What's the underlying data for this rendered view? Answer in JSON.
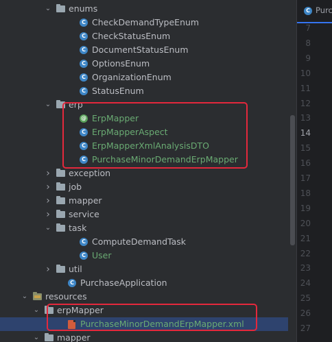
{
  "tree": {
    "rows": [
      {
        "indent": 4,
        "expand": "open",
        "icon": "folder-icon",
        "label": "enums",
        "green": false
      },
      {
        "indent": 6,
        "expand": "none",
        "icon": "class-icon",
        "label": "CheckDemandTypeEnum",
        "green": false
      },
      {
        "indent": 6,
        "expand": "none",
        "icon": "class-icon",
        "label": "CheckStatusEnum",
        "green": false
      },
      {
        "indent": 6,
        "expand": "none",
        "icon": "class-icon",
        "label": "DocumentStatusEnum",
        "green": false
      },
      {
        "indent": 6,
        "expand": "none",
        "icon": "class-icon",
        "label": "OptionsEnum",
        "green": false
      },
      {
        "indent": 6,
        "expand": "none",
        "icon": "class-icon",
        "label": "OrganizationEnum",
        "green": false
      },
      {
        "indent": 6,
        "expand": "none",
        "icon": "class-icon",
        "label": "StatusEnum",
        "green": false
      },
      {
        "indent": 4,
        "expand": "open",
        "icon": "folder-icon",
        "label": "erp",
        "green": false
      },
      {
        "indent": 6,
        "expand": "none",
        "icon": "annotation-icon",
        "label": "ErpMapper",
        "green": true
      },
      {
        "indent": 6,
        "expand": "none",
        "icon": "class-icon",
        "label": "ErpMapperAspect",
        "green": true
      },
      {
        "indent": 6,
        "expand": "none",
        "icon": "class-icon",
        "label": "ErpMapperXmlAnalysisDTO",
        "green": true
      },
      {
        "indent": 6,
        "expand": "none",
        "icon": "class-icon",
        "label": "PurchaseMinorDemandErpMapper",
        "green": true
      },
      {
        "indent": 4,
        "expand": "closed",
        "icon": "folder-icon",
        "label": "exception",
        "green": false
      },
      {
        "indent": 4,
        "expand": "closed",
        "icon": "folder-icon",
        "label": "job",
        "green": false
      },
      {
        "indent": 4,
        "expand": "closed",
        "icon": "folder-icon",
        "label": "mapper",
        "green": false
      },
      {
        "indent": 4,
        "expand": "closed",
        "icon": "folder-icon",
        "label": "service",
        "green": false
      },
      {
        "indent": 4,
        "expand": "open",
        "icon": "folder-icon",
        "label": "task",
        "green": false
      },
      {
        "indent": 6,
        "expand": "none",
        "icon": "class-icon",
        "label": "ComputeDemandTask",
        "green": false
      },
      {
        "indent": 6,
        "expand": "none",
        "icon": "class-icon",
        "label": "User",
        "green": true
      },
      {
        "indent": 4,
        "expand": "closed",
        "icon": "folder-icon",
        "label": "util",
        "green": false
      },
      {
        "indent": 5,
        "expand": "none",
        "icon": "app-icon",
        "label": "PurchaseApplication",
        "green": false
      },
      {
        "indent": 2,
        "expand": "open",
        "icon": "resources-folder-icon",
        "label": "resources",
        "green": false
      },
      {
        "indent": 3,
        "expand": "open",
        "icon": "folder-icon",
        "label": "erpMapper",
        "green": false
      },
      {
        "indent": 5,
        "expand": "none",
        "icon": "xml-file-icon",
        "label": "PurchaseMinorDemandErpMapper.xml",
        "green": true,
        "selected": true
      },
      {
        "indent": 3,
        "expand": "open",
        "icon": "folder-icon",
        "label": "mapper",
        "green": false
      }
    ]
  },
  "editor": {
    "tab_label": "Purc",
    "line_numbers": [
      "7",
      "8",
      "9",
      "10",
      "11",
      "12",
      "13",
      "14",
      "15",
      "16",
      "17",
      "18",
      "19",
      "20",
      "21",
      "22",
      "23",
      "24",
      "25",
      "26",
      "27"
    ],
    "current_line": "14"
  },
  "colors": {
    "background": "#2b2d30",
    "text": "#bcbec4",
    "green_text": "#6aab73",
    "highlight_box": "#e5283c",
    "selection": "#2e436e"
  }
}
